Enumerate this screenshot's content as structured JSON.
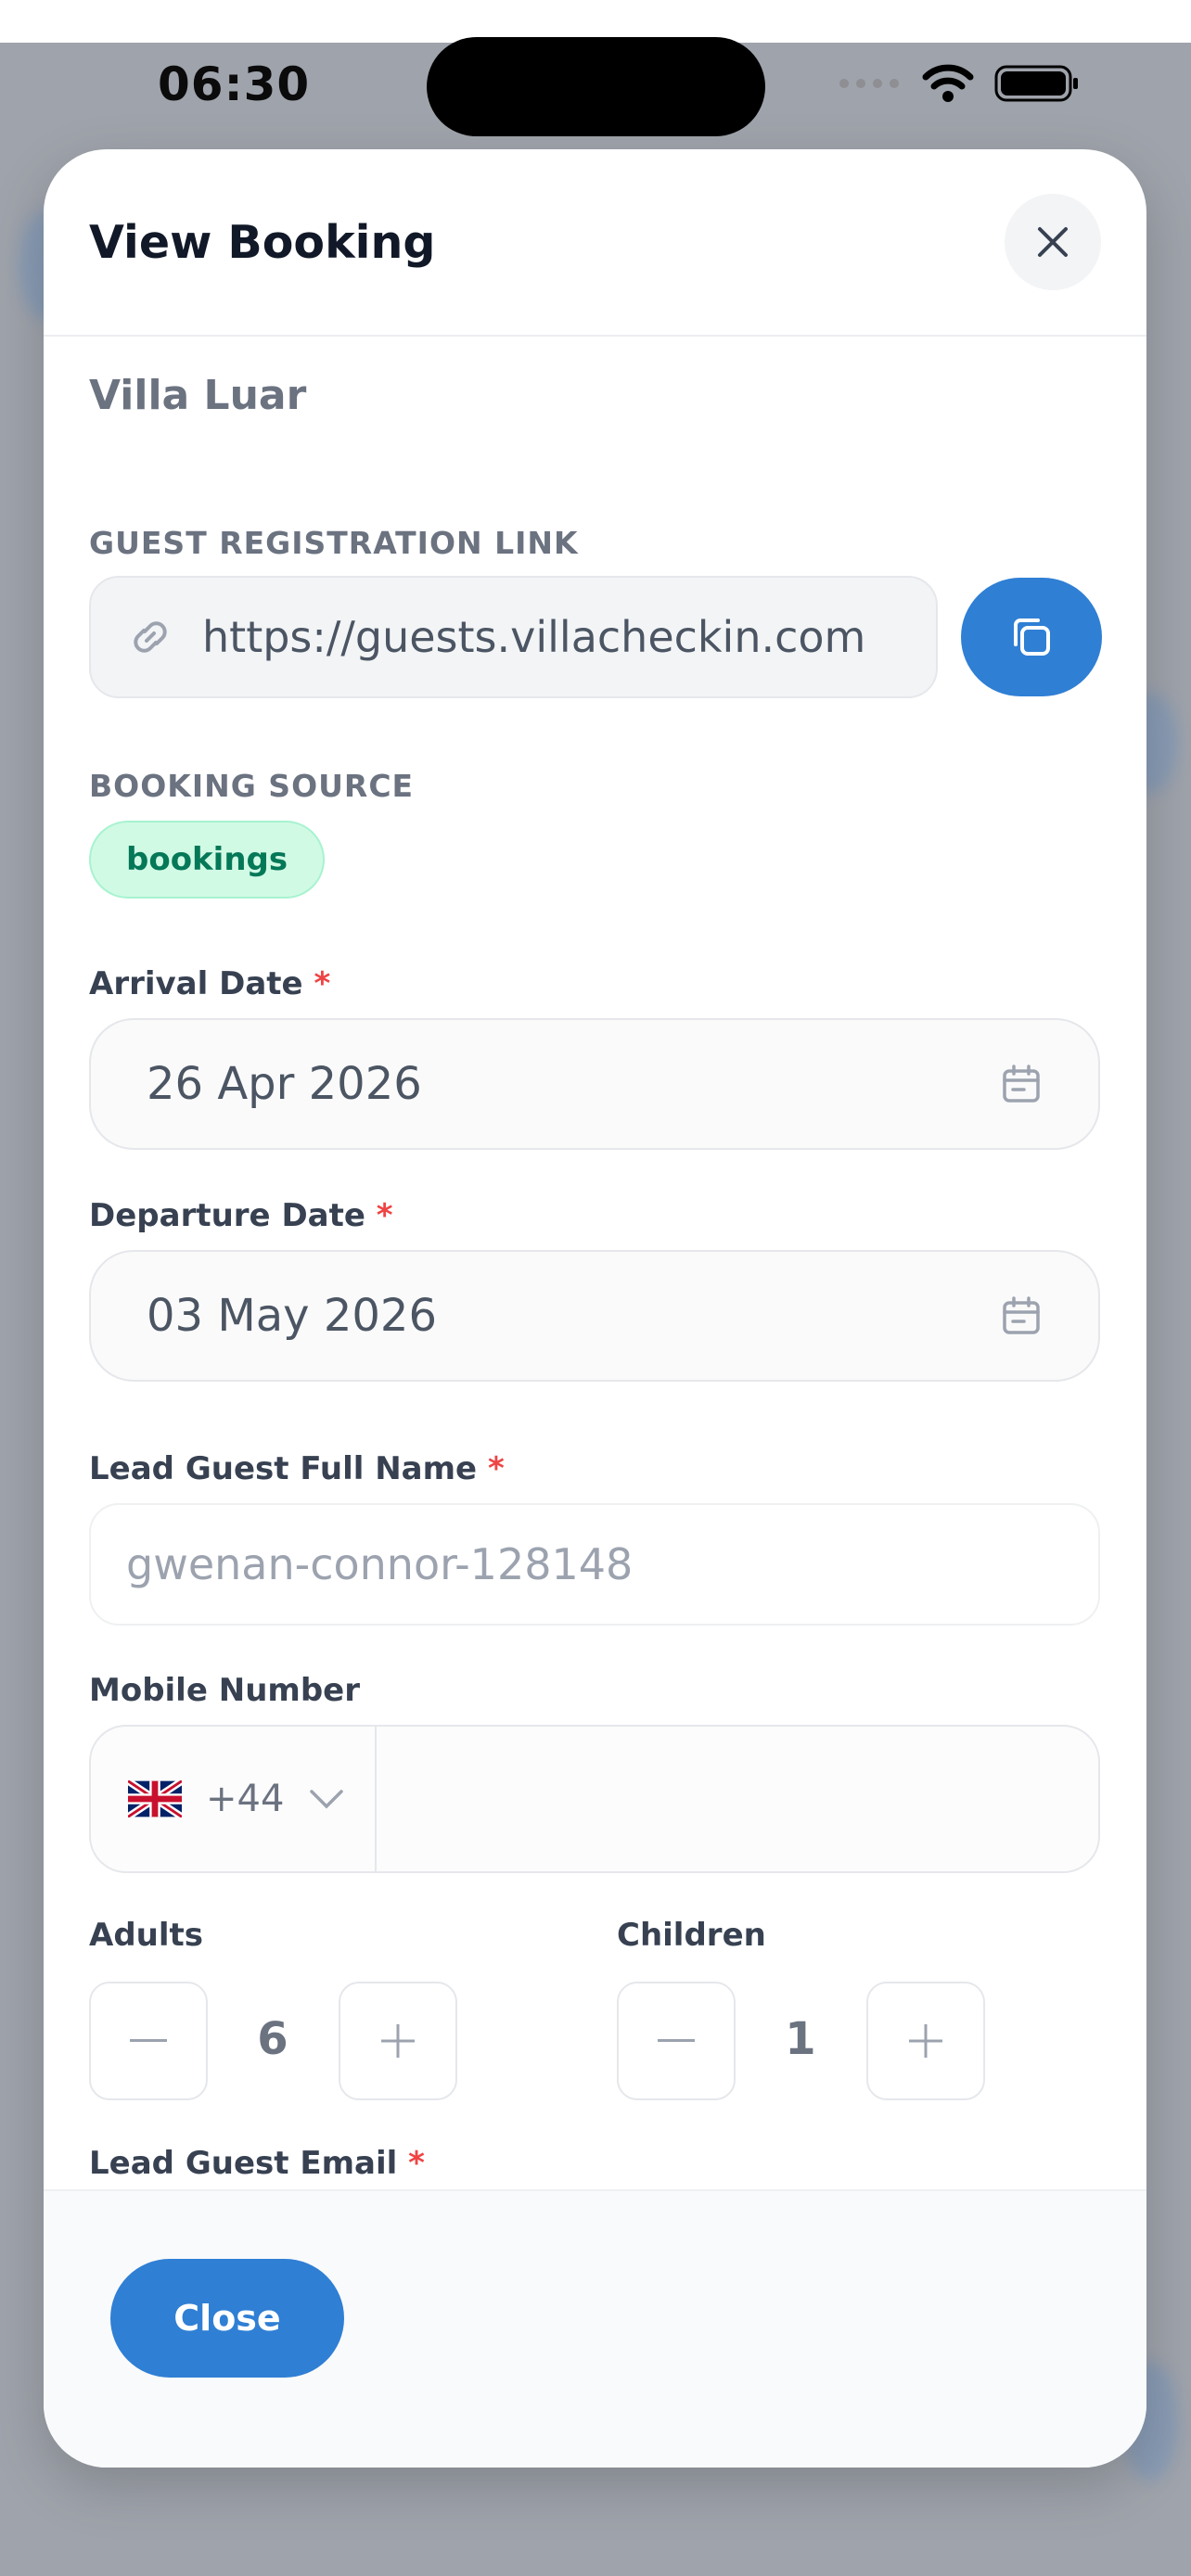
{
  "status_bar": {
    "time": "06:30"
  },
  "modal": {
    "title": "View Booking",
    "villa_name": "Villa Luar",
    "guest_link": {
      "label": "GUEST REGISTRATION LINK",
      "value": "https://guests.villacheckin.com"
    },
    "booking_source": {
      "label": "BOOKING SOURCE",
      "value": "bookings"
    },
    "arrival": {
      "label": "Arrival Date",
      "required": "*",
      "value": "26 Apr 2026"
    },
    "departure": {
      "label": "Departure Date",
      "required": "*",
      "value": "03 May 2026"
    },
    "lead_guest": {
      "label": "Lead Guest Full Name",
      "required": "*",
      "placeholder": "gwenan-connor-128148"
    },
    "mobile": {
      "label": "Mobile Number",
      "country_code": "+44",
      "flag": "uk-flag-icon",
      "value": ""
    },
    "adults": {
      "label": "Adults",
      "value": "6"
    },
    "children": {
      "label": "Children",
      "value": "1"
    },
    "lead_email": {
      "label": "Lead Guest Email",
      "required": "*"
    },
    "footer": {
      "close_label": "Close"
    }
  },
  "colors": {
    "primary": "#2f7fd4",
    "pill_bg": "#d1fae5",
    "pill_text": "#047857",
    "required": "#ef4444"
  }
}
